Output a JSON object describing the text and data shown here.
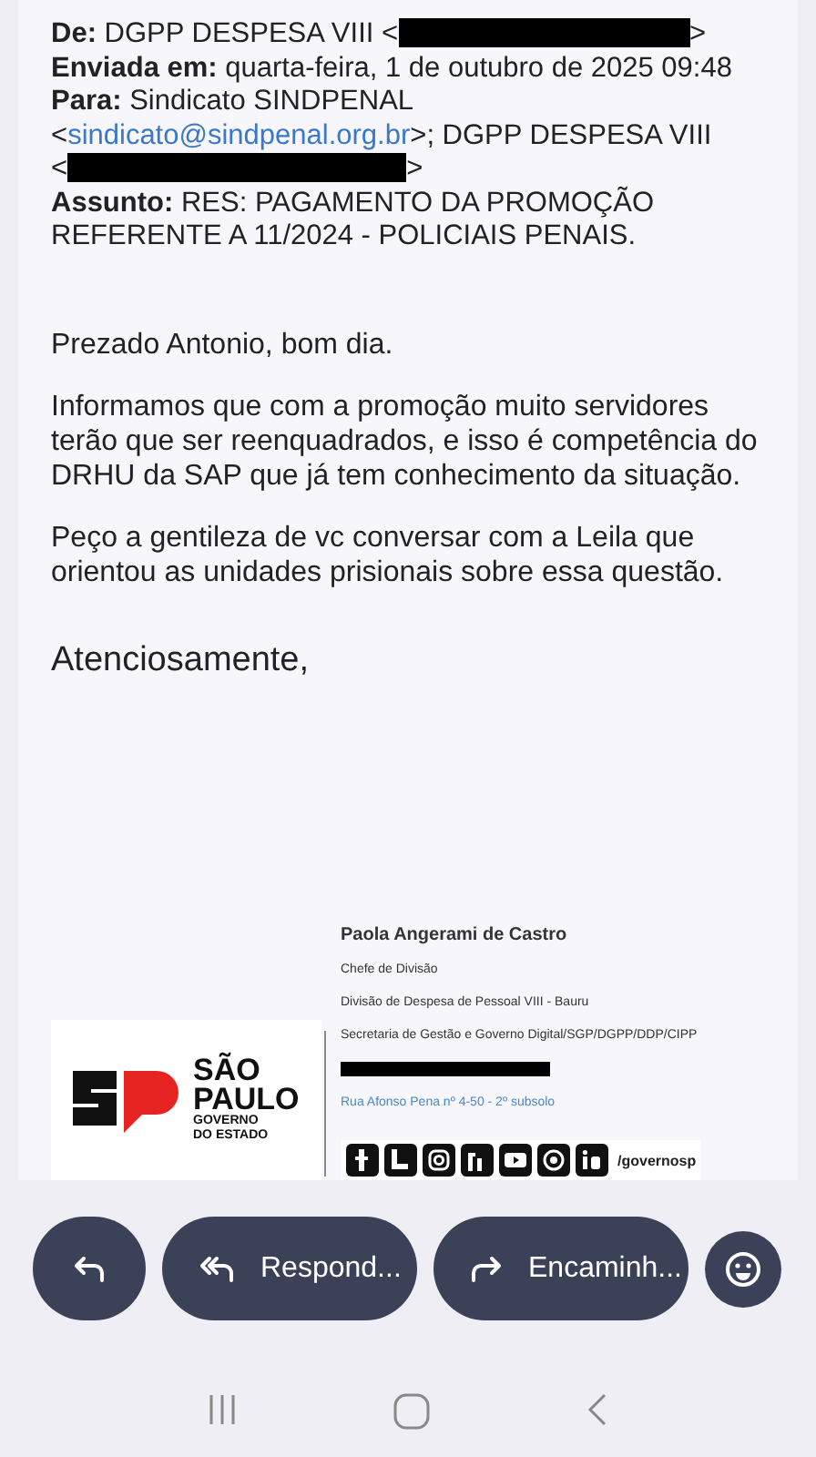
{
  "header": [
    {
      "label": "De:",
      "segments": [
        {
          "kind": "text",
          "text": "DGPP DESPESA VIII <"
        },
        {
          "kind": "redacted"
        },
        {
          "kind": "text",
          "text": ">"
        }
      ]
    },
    {
      "label": "Enviada em:",
      "segments": [
        {
          "kind": "text",
          "text": "quarta-feira, 1 de outubro de 2025 09:48"
        }
      ]
    },
    {
      "label": "Para:",
      "segments": [
        {
          "kind": "text",
          "text": "Sindicato SINDPENAL"
        },
        {
          "kind": "break"
        },
        {
          "kind": "text",
          "text": "<"
        },
        {
          "kind": "link",
          "text": "sindicato@sindpenal.org.br"
        },
        {
          "kind": "text",
          "text": ">; DGPP DESPESA VIII"
        },
        {
          "kind": "break"
        },
        {
          "kind": "text",
          "text": "<"
        },
        {
          "kind": "redacted"
        },
        {
          "kind": "text",
          "text": ">"
        }
      ]
    },
    {
      "label": "Assunto:",
      "segments": [
        {
          "kind": "text",
          "text": "RES: PAGAMENTO DA PROMOÇÃO REFERENTE A 11/2024 - POLICIAIS PENAIS."
        }
      ]
    }
  ],
  "body": [
    "Prezado Antonio, bom dia.",
    "Informamos que com a promoção muito servidores terão que ser reenquadrados, e isso é competência do DRHU da SAP que já tem conhecimento da situação.",
    "Peço a gentileza de vc conversar com a Leila que orientou as unidades prisionais sobre essa questão."
  ],
  "closing": "Atenciosamente,",
  "signature": {
    "name": "Paola Angerami de Castro",
    "lines": [
      {
        "kind": "text",
        "text": "Chefe de Divisão"
      },
      {
        "kind": "text",
        "text": "Divisão de Despesa de Pessoal VIII - Bauru"
      },
      {
        "kind": "text",
        "text": "Secretaria de Gestão e Governo Digital/SGP/DGPP/DDP/CIPP"
      },
      {
        "kind": "redacted"
      },
      {
        "kind": "address",
        "text": "Rua Afonso Pena nº 4-50 - 2º subsolo"
      }
    ],
    "logo": {
      "title": [
        "SÃO",
        "PAULO"
      ],
      "subtitle": [
        "GOVERNO",
        "DO ESTADO"
      ]
    },
    "social_handle": "/governosp"
  },
  "actions": [
    {
      "kind": "reply"
    },
    {
      "kind": "reply-all",
      "label": "Respond..."
    },
    {
      "kind": "forward",
      "label": "Encaminh..."
    },
    {
      "kind": "emoji"
    }
  ]
}
